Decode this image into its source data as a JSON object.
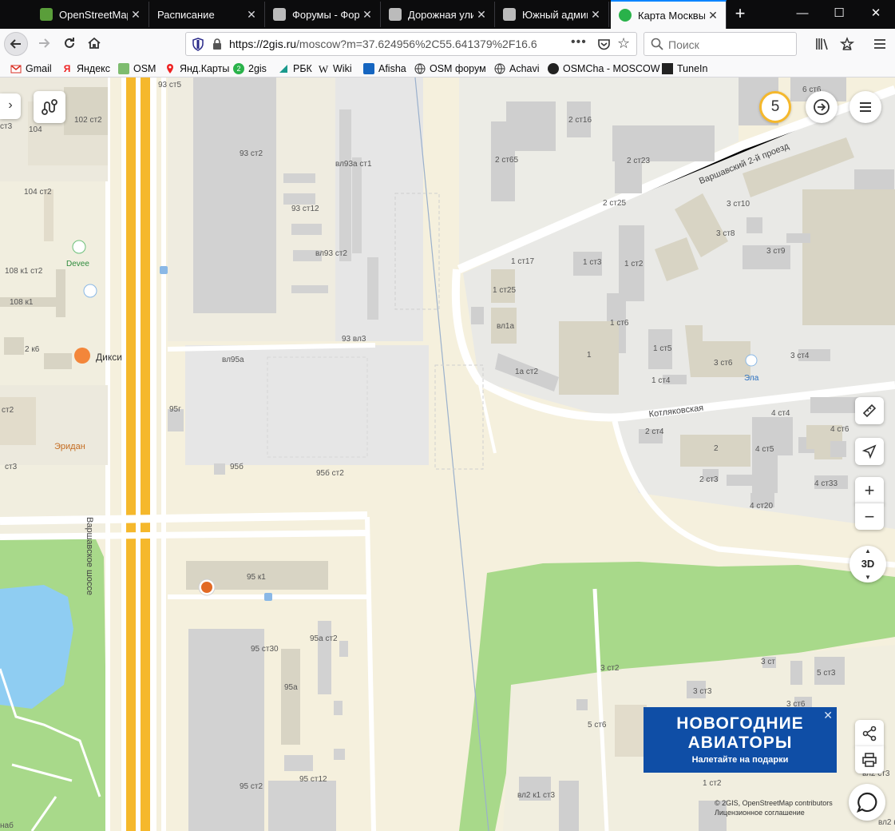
{
  "tabs": [
    {
      "title": "OpenStreetMap",
      "fav": "#5a9e3a"
    },
    {
      "title": "Расписание",
      "fav": ""
    },
    {
      "title": "Форумы - Фору",
      "fav": "#888"
    },
    {
      "title": "Дорожная улиц",
      "fav": "#888"
    },
    {
      "title": "Южный админи",
      "fav": "#888"
    },
    {
      "title": "Карта Москвы:",
      "fav": "#29b24a"
    }
  ],
  "window": {
    "minimize": "—",
    "maximize": "☐",
    "close": "✕"
  },
  "nav": {
    "url_domain": "https://2gis.ru",
    "url_path": "/moscow?m=37.624956%2C55.641379%2F16.6",
    "search_placeholder": "Поиск",
    "more": "•••"
  },
  "bookmarks": [
    "Gmail",
    "Яндекс",
    "OSM",
    "Янд.Карты",
    "2gis",
    "РБК",
    "Wiki",
    "Afisha",
    "OSM форум",
    "Achavi",
    "OSMCha - MOSCOW",
    "TuneIn"
  ],
  "map": {
    "roads": {
      "varsh": "Варшавское шоссе",
      "varsh2": "Варшавский 2-й проезд",
      "kotl": "Котляковская"
    },
    "labels": [
      "93 ст5",
      "102 ст2",
      "104",
      "ст3",
      "93 ст2",
      "вл93а ст1",
      "104 ст2",
      "93 ст12",
      "вл93 ст2",
      "Devee",
      "108 к1 ст2",
      "108 к1",
      "2 к6",
      "93 вл3",
      "вл95а",
      "95г",
      "95б",
      "95б ст2",
      "ст2",
      "ст3",
      "95 к1",
      "95а ст2",
      "95 ст30",
      "95а",
      "95 ст12",
      "95 ст2",
      "наб",
      "6 ст6",
      "2 ст16",
      "2 ст65",
      "2 ст23",
      "2 ст25",
      "3 ст10",
      "3 ст8",
      "3 ст9",
      "1 ст17",
      "1 ст3",
      "1 ст2",
      "1 ст25",
      "вл1а",
      "1 ст6",
      "1",
      "1 ст5",
      "3 ст6",
      "3 ст4",
      "1а ст2",
      "1 ст4",
      "Эла",
      "4 ст4",
      "4 ст6",
      "2 ст4",
      "2",
      "4 ст5",
      "2 ст3",
      "4 ст33",
      "4 ст20",
      "3 ст",
      "3 ст2",
      "3 ст3",
      "5 ст3",
      "3 ст6",
      "5 ст6",
      "1 ст2",
      "вл2 к1 ст3",
      "вл2 ст3",
      "вл2 к1 ст6",
      "вл2"
    ],
    "poi": {
      "diksi": "Дикси",
      "eridan": "Эридан"
    },
    "badge": "5",
    "btn3d": "3D",
    "ad": {
      "line1": "НОВОГОДНИЕ",
      "line2": "АВИАТОРЫ",
      "line3": "Налетайте на подарки"
    },
    "copyright": "© 2GIS, OpenStreetMap contributors",
    "license": "Лицензионное соглашение"
  },
  "colors": {
    "accent": "#0a84ff",
    "water": "#8fcdf2",
    "park": "#a8d98a",
    "building": "#d2d2d2",
    "badge": "#f5b82c",
    "ad": "#0f4ea6"
  }
}
